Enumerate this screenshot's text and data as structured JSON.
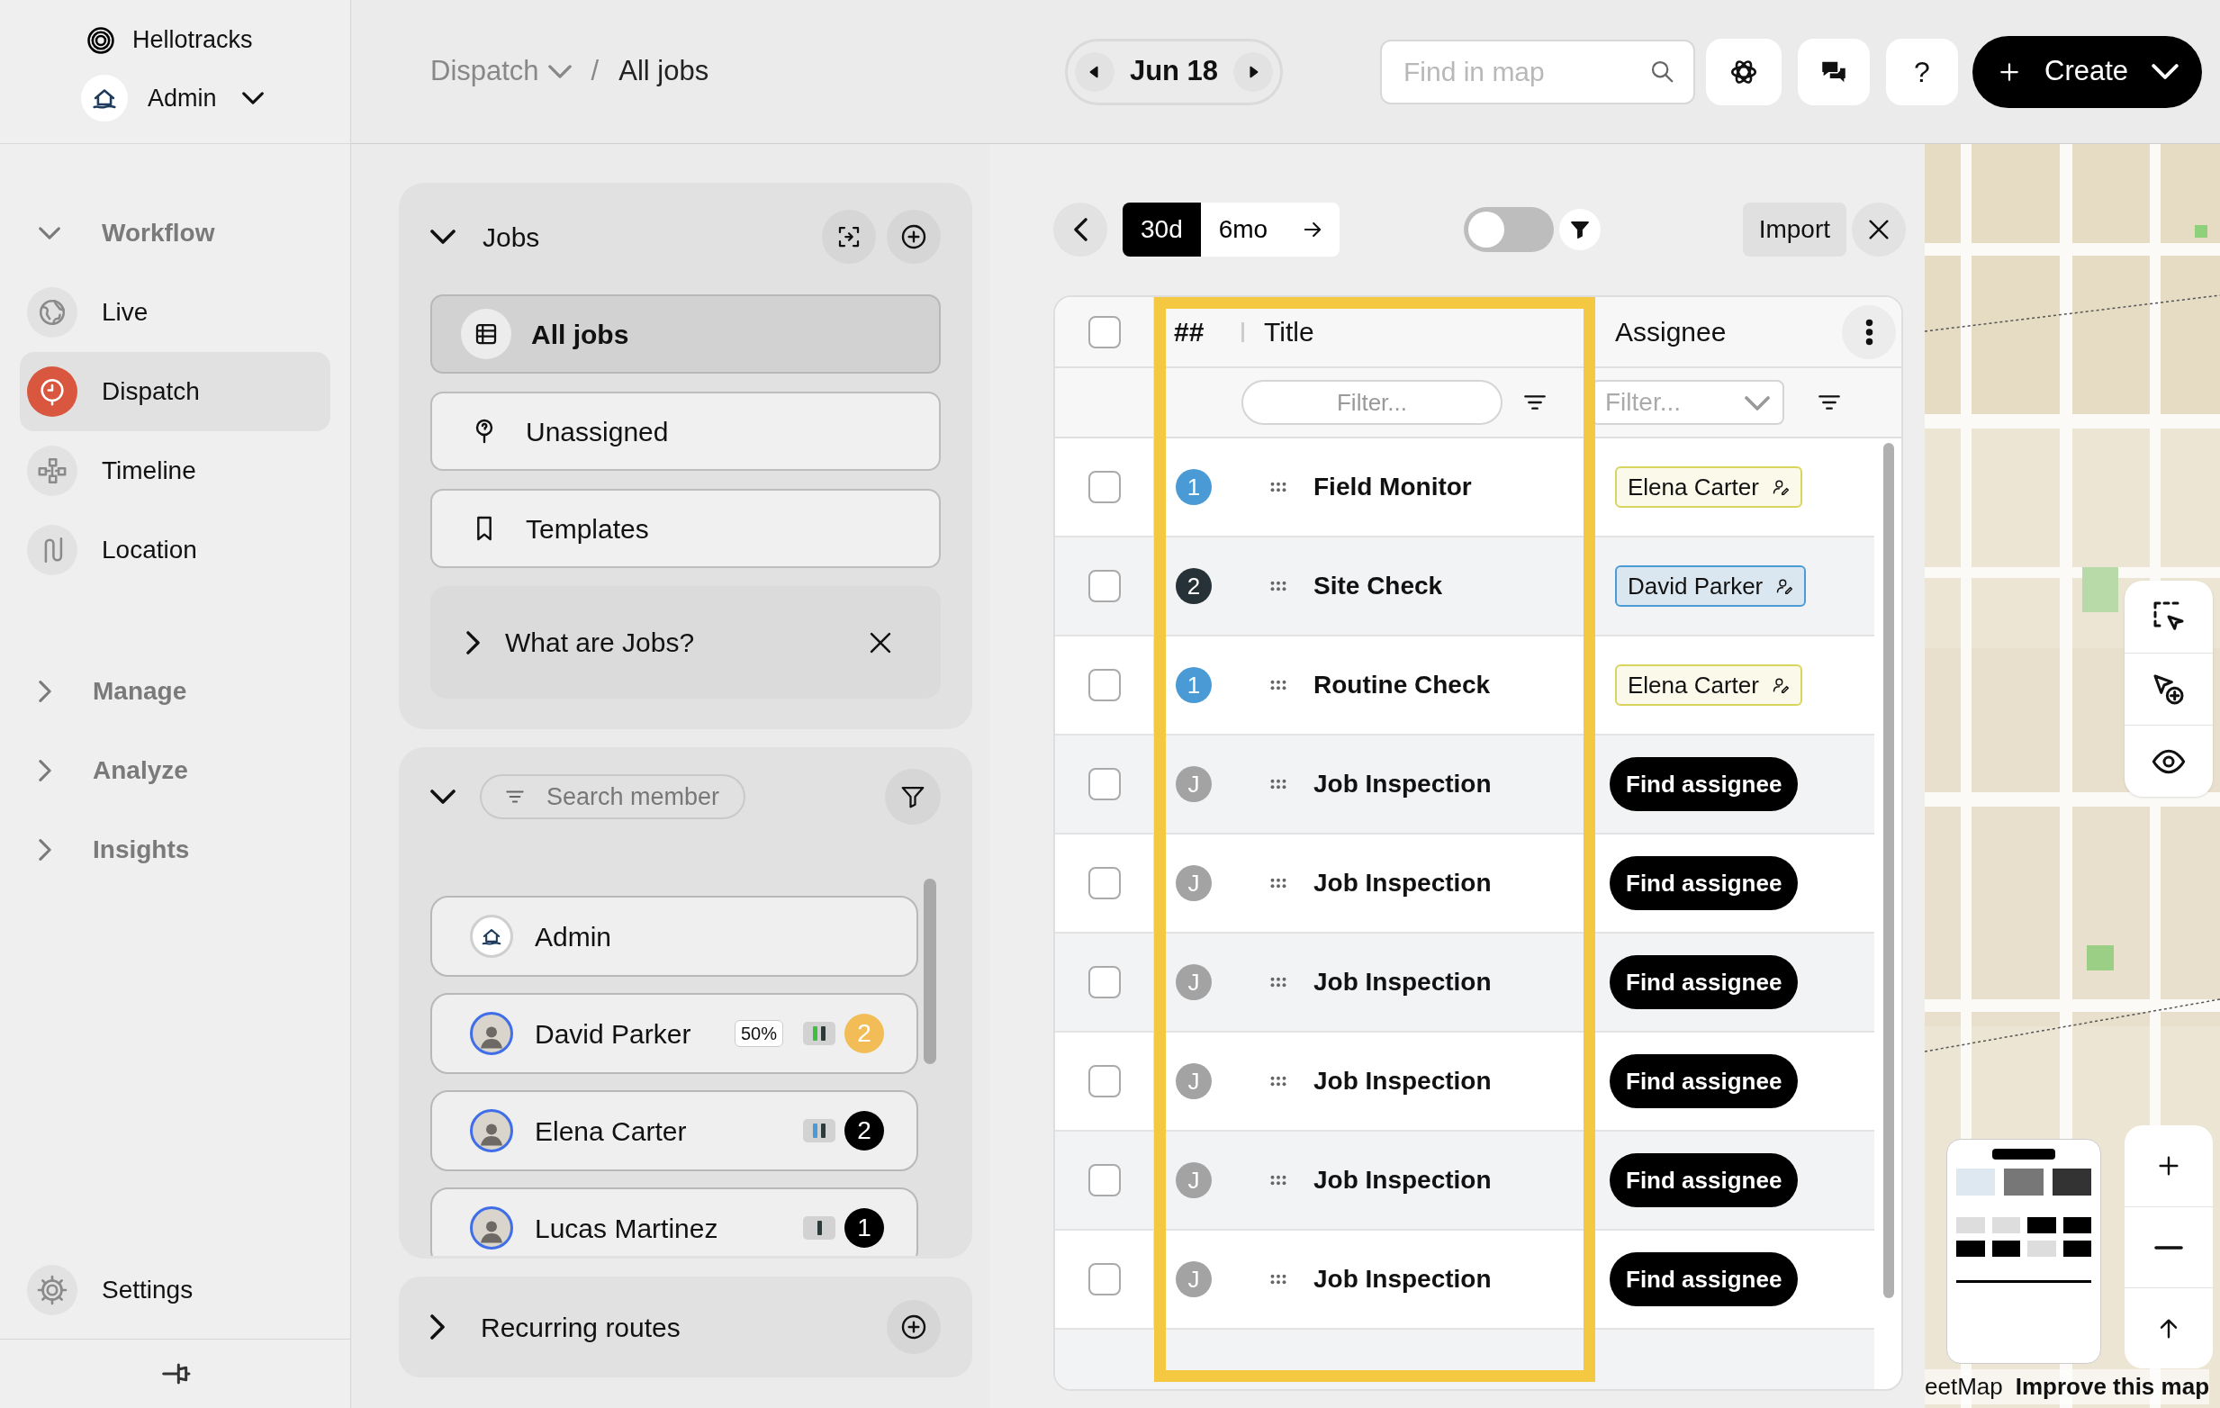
{
  "sidebar": {
    "brand": "Hellotracks",
    "account": {
      "name": "Admin"
    },
    "nav": [
      {
        "label": "Workflow",
        "expanded": true,
        "children": [
          {
            "label": "Live",
            "selected": false
          },
          {
            "label": "Dispatch",
            "selected": true
          },
          {
            "label": "Timeline",
            "selected": false
          },
          {
            "label": "Location",
            "selected": false
          }
        ]
      },
      {
        "label": "Manage",
        "expanded": false
      },
      {
        "label": "Analyze",
        "expanded": false
      },
      {
        "label": "Insights",
        "expanded": false
      }
    ],
    "settings": "Settings"
  },
  "header": {
    "breadcrumb": [
      {
        "label": "Dispatch",
        "dropdown": true
      },
      {
        "label": "All jobs",
        "dropdown": false
      }
    ],
    "separator": "/",
    "date": "Jun 18",
    "search": {
      "placeholder": "Find in map"
    },
    "help": "?",
    "create": "Create"
  },
  "jobs_panel": {
    "title": "Jobs",
    "expanded": true,
    "views": [
      {
        "label": "All jobs",
        "selected": true
      },
      {
        "label": "Unassigned",
        "selected": false
      },
      {
        "label": "Templates",
        "selected": false
      }
    ],
    "info": {
      "label": "What are Jobs?"
    }
  },
  "members_panel": {
    "expanded": true,
    "search": {
      "placeholder": "Search member"
    },
    "members": [
      {
        "name": "Admin",
        "kind": "company"
      },
      {
        "name": "David Parker",
        "kind": "person",
        "utilization": "50%",
        "bars": [
          {
            "color": "#3fbf3f"
          },
          {
            "color": "#2d3a3a"
          }
        ],
        "count": "2",
        "color": "#f2bd56"
      },
      {
        "name": "Elena Carter",
        "kind": "person",
        "bars": [
          {
            "color": "#4a9bd5"
          },
          {
            "color": "#2d3a3a"
          }
        ],
        "count": "2",
        "color": "#000000"
      },
      {
        "name": "Lucas Martinez",
        "kind": "person",
        "bars": [
          {
            "color": "#2d3a3a"
          }
        ],
        "count": "1",
        "color": "#000000"
      }
    ]
  },
  "recurring_routes": {
    "title": "Recurring routes",
    "expanded": false
  },
  "toolbar": {
    "ranges": [
      {
        "label": "30d",
        "selected": true
      },
      {
        "label": "6mo",
        "selected": false
      }
    ],
    "toggle": {
      "on": false
    },
    "import": "Import"
  },
  "table": {
    "select_all": {
      "checked": false
    },
    "columns": [
      "##",
      "Title",
      "Assignee"
    ],
    "filters": [
      {
        "placeholder": "Filter..."
      },
      {
        "placeholder": "Filter..."
      }
    ],
    "rows": [
      {
        "checked": false,
        "badge": {
          "text": "1",
          "color": "#4a9bd5"
        },
        "title": "Field Monitor",
        "assignee": {
          "kind": "chip",
          "name": "Elena Carter",
          "color": "#d8d55f"
        }
      },
      {
        "checked": false,
        "badge": {
          "text": "2",
          "color": "#263238"
        },
        "title": "Site Check",
        "assignee": {
          "kind": "chip",
          "name": "David Parker",
          "color": "#4b9cd5"
        }
      },
      {
        "checked": false,
        "badge": {
          "text": "1",
          "color": "#4a9bd5"
        },
        "title": "Routine Check",
        "assignee": {
          "kind": "chip",
          "name": "Elena Carter",
          "color": "#d8d55f"
        }
      },
      {
        "checked": false,
        "badge": {
          "text": "J",
          "color": "#a3a3a3"
        },
        "title": "Job Inspection",
        "assignee": {
          "kind": "button",
          "name": "Find assignee"
        }
      },
      {
        "checked": false,
        "badge": {
          "text": "J",
          "color": "#a3a3a3"
        },
        "title": "Job Inspection",
        "assignee": {
          "kind": "button",
          "name": "Find assignee"
        }
      },
      {
        "checked": false,
        "badge": {
          "text": "J",
          "color": "#a3a3a3"
        },
        "title": "Job Inspection",
        "assignee": {
          "kind": "button",
          "name": "Find assignee"
        }
      },
      {
        "checked": false,
        "badge": {
          "text": "J",
          "color": "#a3a3a3"
        },
        "title": "Job Inspection",
        "assignee": {
          "kind": "button",
          "name": "Find assignee"
        }
      },
      {
        "checked": false,
        "badge": {
          "text": "J",
          "color": "#a3a3a3"
        },
        "title": "Job Inspection",
        "assignee": {
          "kind": "button",
          "name": "Find assignee"
        }
      },
      {
        "checked": false,
        "badge": {
          "text": "J",
          "color": "#a3a3a3"
        },
        "title": "Job Inspection",
        "assignee": {
          "kind": "button",
          "name": "Find assignee"
        }
      }
    ]
  },
  "map": {
    "kind": "picture",
    "attribution": [
      "eetMap",
      "Improve this map"
    ]
  }
}
